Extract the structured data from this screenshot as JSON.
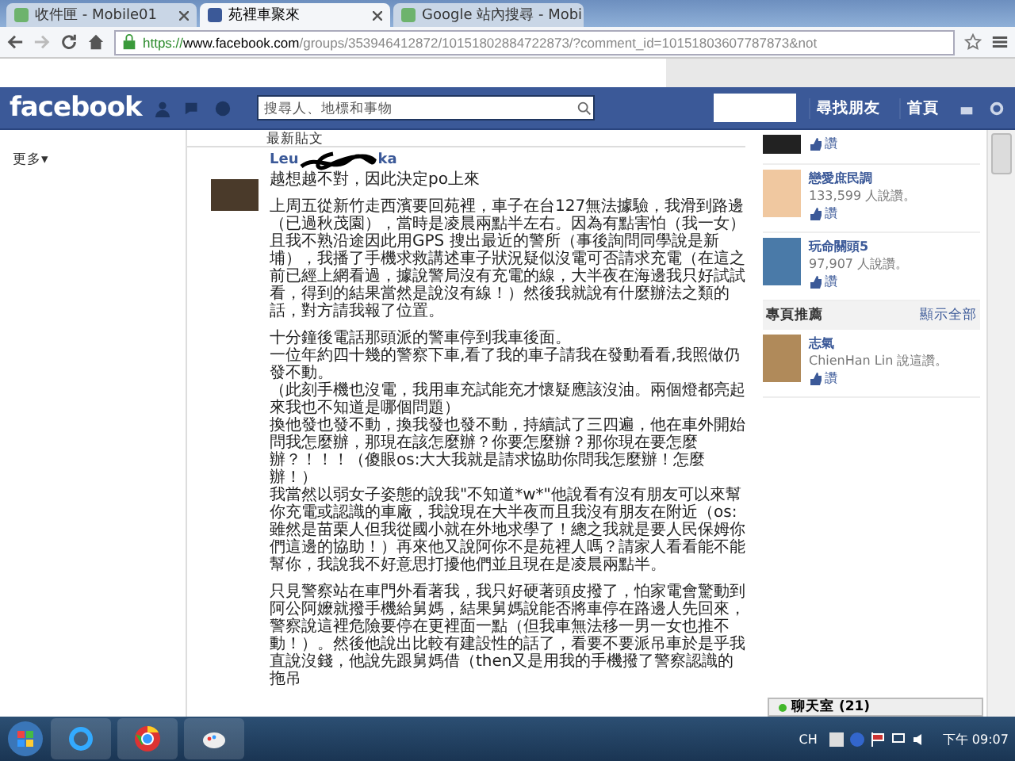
{
  "browser": {
    "tabs": [
      {
        "label": "收件匣 - Mobile01",
        "selected": false,
        "kind": "site"
      },
      {
        "label": "苑裡車聚來",
        "selected": true,
        "kind": "facebook"
      },
      {
        "label": "Google 站內搜尋 - Mobi",
        "selected": false,
        "kind": "site"
      }
    ],
    "url_secure": "https://",
    "url_host": "www.facebook.com",
    "url_path": "/groups/353946412872/10151802884722873/?comment_id=10151803607787873&not"
  },
  "header": {
    "logo": "facebook",
    "search": {
      "placeholder": "搜尋人、地標和事物"
    },
    "links": [
      "尋找朋友",
      "首頁"
    ]
  },
  "sidebar": {
    "more": "更多▾"
  },
  "feed": {
    "heading": "最新貼文",
    "post": {
      "author_start": "Leu",
      "author_end": "ka",
      "first_line": "越想越不對，因此決定po上來",
      "paragraphs": [
        [
          "上周五從新竹走西濱要回苑裡，車子在台127無法據驗，我滑到路邊（已過秋茂園），當時是凌晨兩點半左右。因為有點害怕（我一女）且我不熟沿途因此用GPS 搜出最近的警所（事後詢問同學說是新埔），我播了手機求救講述車子狀況疑似沒電可否請求充電（在這之前已經上網看過，據說警局沒有充電的線，大半夜在海邊我只好試試看，得到的結果當然是說沒有線！）然後我就說有什麼辦法之類的話，對方請我報了位置。"
        ],
        [
          "十分鐘後電話那頭派的警車停到我車後面。",
          "一位年約四十幾的警察下車,看了我的車子請我在發動看看,我照做仍發不動。",
          "（此刻手機也沒電，我用車充試能充才懷疑應該沒油。兩個燈都亮起來我也不知道是哪個問題）",
          "換他發也發不動，換我發也發不動，持續試了三四遍，他在車外開始問我怎麼辦，那現在該怎麼辦？你要怎麼辦？那你現在要怎麼辦？！！！（傻眼os:大大我就是請求協助你問我怎麼辦！怎麼辦！）",
          "我當然以弱女子姿態的說我\"不知道*w*\"他說看有沒有朋友可以來幫你充電或認識的車廠，我說現在大半夜而且我沒有朋友在附近（os:雖然是苗栗人但我從國小就在外地求學了！總之我就是要人民保姆你們這邊的協助！）再來他又說阿你不是苑裡人嗎？請家人看看能不能幫你，我說我不好意思打擾他們並且現在是凌晨兩點半。"
        ],
        [
          "只見警察站在車門外看著我，我只好硬著頭皮撥了，怕家電會驚動到阿公阿嬤就撥手機給舅媽，結果舅媽說能否將車停在路邊人先回來，警察說這裡危險要停在更裡面一點（但我車無法移一男一女也推不動！）。然後他說出比較有建設性的話了，看要不要派吊車於是乎我直說沒錢，他說先跟舅媽借（then又是用我的手機撥了警察認識的拖吊"
        ]
      ]
    }
  },
  "right_column": {
    "pages": [
      {
        "like": "讚"
      },
      {
        "name": "戀愛庶民調",
        "likes": "133,599 人說讚。",
        "like": "讚"
      },
      {
        "name": "玩命關頭5",
        "likes": "97,907 人說讚。",
        "like": "讚"
      }
    ],
    "recommended": {
      "title": "專頁推薦",
      "show_all": "顯示全部",
      "items": [
        {
          "name": "志氣",
          "likes": "ChienHan Lin 說這讚。",
          "like": "讚"
        }
      ]
    }
  },
  "chat": {
    "label": "聊天室 (21)"
  },
  "taskbar": {
    "language": "CH",
    "time": "下午 09:07"
  }
}
